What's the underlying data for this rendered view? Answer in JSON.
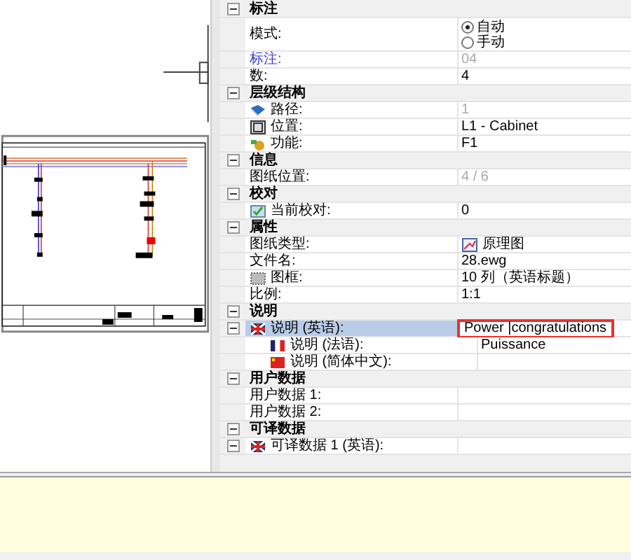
{
  "properties": {
    "groups": [
      {
        "title": "标注",
        "expanded": true,
        "rows": [
          {
            "kind": "radio",
            "label": "模式:",
            "options": [
              {
                "label": "自动",
                "selected": true
              },
              {
                "label": "手动",
                "selected": false
              }
            ]
          },
          {
            "kind": "plain",
            "label": "标注:",
            "value": "04",
            "label_link": true,
            "disabled": true
          },
          {
            "kind": "plain",
            "label": "数:",
            "value": "4"
          }
        ]
      },
      {
        "title": "层级结构",
        "expanded": true,
        "rows": [
          {
            "kind": "path",
            "label": "路径:",
            "value": "1",
            "disabled": true
          },
          {
            "kind": "location",
            "label": "位置:",
            "value": "L1 - Cabinet"
          },
          {
            "kind": "function",
            "label": "功能:",
            "value": "F1"
          }
        ]
      },
      {
        "title": "信息",
        "expanded": true,
        "rows": [
          {
            "kind": "plain",
            "label": "图纸位置:",
            "value": "4 / 6",
            "disabled": true
          }
        ]
      },
      {
        "title": "校对",
        "expanded": true,
        "rows": [
          {
            "kind": "review",
            "label": "当前校对:",
            "value": "0"
          }
        ]
      },
      {
        "title": "属性",
        "expanded": true,
        "rows": [
          {
            "kind": "doctype",
            "label": "图纸类型:",
            "value": "原理图"
          },
          {
            "kind": "plain",
            "label": "文件名:",
            "value": "28.ewg"
          },
          {
            "kind": "frame",
            "label": "图框:",
            "value": "10 列（英语标题）"
          },
          {
            "kind": "plain",
            "label": "比例:",
            "value": "1:1"
          }
        ]
      },
      {
        "title": "说明",
        "expanded": true,
        "rows": [
          {
            "kind": "english",
            "label": "说明 (英语):",
            "value": "Power |congratulations",
            "selected": true,
            "expanded": true,
            "children": [
              {
                "kind": "french",
                "label": "说明 (法语):",
                "value": "Puissance"
              },
              {
                "kind": "chinese",
                "label": "说明 (简体中文):"
              }
            ]
          }
        ]
      },
      {
        "title": "用户数据",
        "expanded": true,
        "rows": [
          {
            "kind": "plain",
            "label": "用户数据 1:"
          },
          {
            "kind": "plain",
            "label": "用户数据 2:"
          }
        ]
      },
      {
        "title": "可译数据",
        "expanded": true,
        "rows": [
          {
            "kind": "english",
            "label": "可译数据 1 (英语):",
            "expanded": true
          }
        ]
      }
    ]
  }
}
